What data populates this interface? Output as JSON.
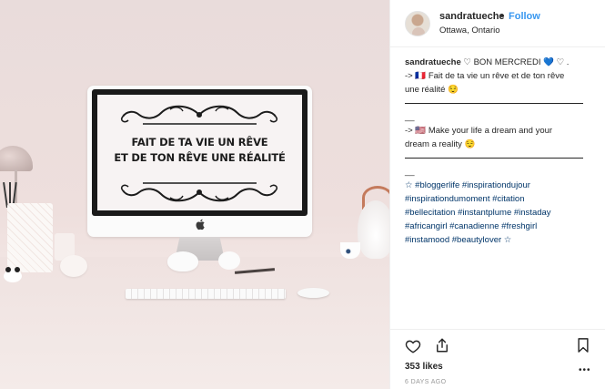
{
  "photo": {
    "screen_quote_line1": "FAIT DE TA VIE UN RÊVE",
    "screen_quote_line2": "ET DE TON RÊVE UNE RÉALITÉ"
  },
  "header": {
    "username": "sandratueche",
    "separator": "•",
    "follow_label": "Follow",
    "location": "Ottawa, Ontario"
  },
  "caption": {
    "username": "sandratueche",
    "line1": " ♡ BON MERCREDI 💙 ♡ .",
    "line2": "-> 🇫🇷 Fait de ta vie un rêve et de ton rêve",
    "line3": "une réalité 😌",
    "dash1": "__",
    "line4": "-> 🇺🇸 Make your life a dream and your",
    "line5": "dream a reality 😌",
    "dash2": "__",
    "hashtags1": "☆ #bloggerlife #inspirationdujour",
    "hashtags2": "#inspirationdumoment #citation",
    "hashtags3": "#bellecitation #instantplume #instaday",
    "hashtags4": "#africangirl #canadienne #freshgirl",
    "hashtags5": "#instamood #beautylover ☆"
  },
  "actions": {
    "likes": "353 likes",
    "more": "•••",
    "date": "6 DAYS AGO",
    "icons": [
      "heart-icon",
      "share-icon",
      "bookmark-icon"
    ]
  },
  "colors": {
    "link_blue": "#3897f0",
    "hashtag_blue": "#003569",
    "text": "#262626",
    "muted": "#999999",
    "border": "#efefef"
  }
}
